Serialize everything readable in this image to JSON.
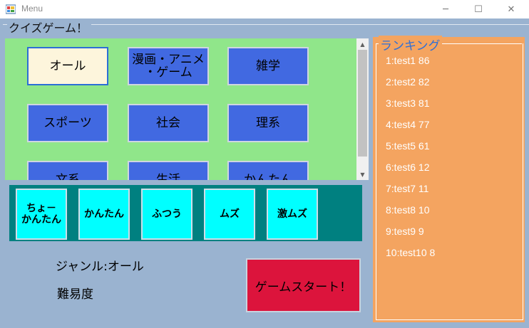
{
  "window": {
    "title": "Menu",
    "minimize_glyph": "─",
    "maximize_glyph": "☐",
    "close_glyph": "✕"
  },
  "group": {
    "title": "クイズゲーム！"
  },
  "genres": [
    {
      "label": "オール",
      "selected": true
    },
    {
      "label": "漫画・アニメ\n・ゲーム",
      "selected": false
    },
    {
      "label": "雑学",
      "selected": false
    },
    {
      "label": "スポーツ",
      "selected": false
    },
    {
      "label": "社会",
      "selected": false
    },
    {
      "label": "理系",
      "selected": false
    },
    {
      "label": "文系",
      "selected": false
    },
    {
      "label": "生活",
      "selected": false
    },
    {
      "label": "かんたん",
      "selected": false
    }
  ],
  "difficulties": [
    {
      "label": "ちょ－\nかんたん"
    },
    {
      "label": "かんたん"
    },
    {
      "label": "ふつう"
    },
    {
      "label": "ムズ"
    },
    {
      "label": "激ムズ"
    }
  ],
  "status": {
    "genre_text": "ジャンル:オール",
    "difficulty_text": "難易度"
  },
  "start_button": {
    "label": "ゲームスタート！"
  },
  "ranking": {
    "title": "ランキング",
    "items": [
      "1:test1   86",
      "2:test2   82",
      "3:test3   81",
      "4:test4   77",
      "5:test5   61",
      "6:test6   12",
      "7:test7   11",
      "8:test8   10",
      "9:test9   9",
      "10:test10   8"
    ]
  },
  "colors": {
    "genre_panel": "#90e68a",
    "genre_button": "#4169e1",
    "genre_selected": "#fdf5dc",
    "difficulty_panel": "#008080",
    "difficulty_button": "#00ffff",
    "start_button": "#dc143c",
    "ranking_panel": "#f4a460",
    "background": "#9ab3d0"
  }
}
